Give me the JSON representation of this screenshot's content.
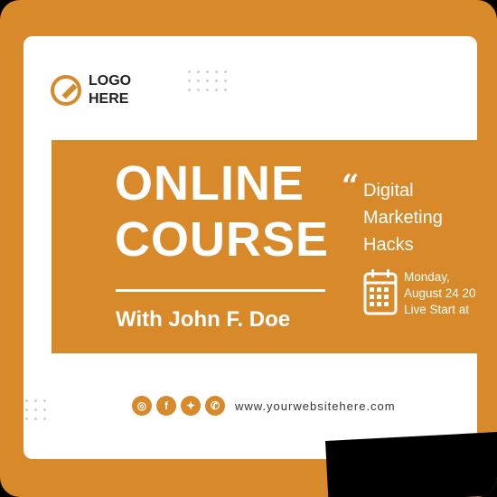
{
  "logo": {
    "line1": "LOGO",
    "line2": "HERE"
  },
  "course": {
    "title_line1": "ONLINE",
    "title_line2": "COURSE",
    "presenter": "With John F. Doe"
  },
  "topic": {
    "quote_glyph": "“",
    "line1": "Digital",
    "line2": "Marketing",
    "line3": "Hacks"
  },
  "schedule": {
    "line1": "Monday,",
    "line2": "August 24 20",
    "line3": "Live Start at"
  },
  "social": [
    {
      "icon": "instagram-icon",
      "glyph": "◎"
    },
    {
      "icon": "facebook-icon",
      "glyph": "f"
    },
    {
      "icon": "twitter-icon",
      "glyph": "✦"
    },
    {
      "icon": "whatsapp-icon",
      "glyph": "✆"
    }
  ],
  "website": "www.yourwebsitehere.com",
  "colors": {
    "accent": "#d88a2b",
    "card": "#ffffff",
    "text": "#222222"
  }
}
